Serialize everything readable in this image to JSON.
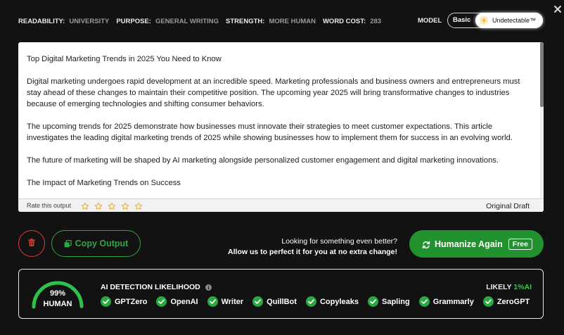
{
  "meta": {
    "readability_label": "READABILITY:",
    "readability_value": "UNIVERSITY",
    "purpose_label": "PURPOSE:",
    "purpose_value": "GENERAL WRITING",
    "strength_label": "STRENGTH:",
    "strength_value": "MORE HUMAN",
    "wordcost_label": "WORD COST:",
    "wordcost_value": "283"
  },
  "model": {
    "label": "MODEL",
    "basic": "Basic",
    "undetectable": "Undetectable™",
    "selected": "Undetectable™"
  },
  "output": {
    "paragraphs": [
      "Top Digital Marketing Trends in 2025 You Need to Know",
      "Digital marketing undergoes rapid development at an incredible speed. Marketing professionals and business owners and entrepreneurs must stay ahead of these changes to maintain their competitive position. The upcoming year 2025 will bring transformative changes to industries because of emerging technologies and shifting consumer behaviors.",
      "The upcoming trends for 2025 demonstrate how businesses must innovate their strategies to meet customer expectations. This article investigates the leading digital marketing trends of 2025 while showing businesses how to implement them for success in an evolving world.",
      "The future of marketing will be shaped by AI marketing alongside personalized customer engagement and digital marketing innovations.",
      "The Impact of Marketing Trends on Success"
    ],
    "rate_label": "Rate this output",
    "star_count": 5,
    "draft_label": "Original Draft"
  },
  "actions": {
    "copy_label": "Copy Output",
    "promo_line1": "Looking for something even better?",
    "promo_line2": "Allow us to perfect it for you at no extra change!",
    "humanize_label": "Humanize Again",
    "free_badge": "Free"
  },
  "detection": {
    "gauge_percent": "99%",
    "gauge_value": 0.99,
    "gauge_label": "HUMAN",
    "title": "AI DETECTION LIKELIHOOD",
    "likely_label": "LIKELY",
    "likely_value": "1%AI",
    "detectors": [
      "GPTZero",
      "OpenAI",
      "Writer",
      "QuillBot",
      "Copyleaks",
      "Sapling",
      "Grammarly",
      "ZeroGPT"
    ]
  },
  "colors": {
    "background": "#121212",
    "accent_green": "#22922f",
    "delete_red": "#e53935",
    "star_gold": "#f2b01e"
  },
  "icons": {
    "close": "close-icon",
    "bolt": "lightning-icon",
    "trash": "trash-icon",
    "copy": "copy-icon",
    "refresh": "refresh-icon",
    "info": "info-icon",
    "check": "check-circle-icon",
    "star": "star-outline-icon"
  }
}
